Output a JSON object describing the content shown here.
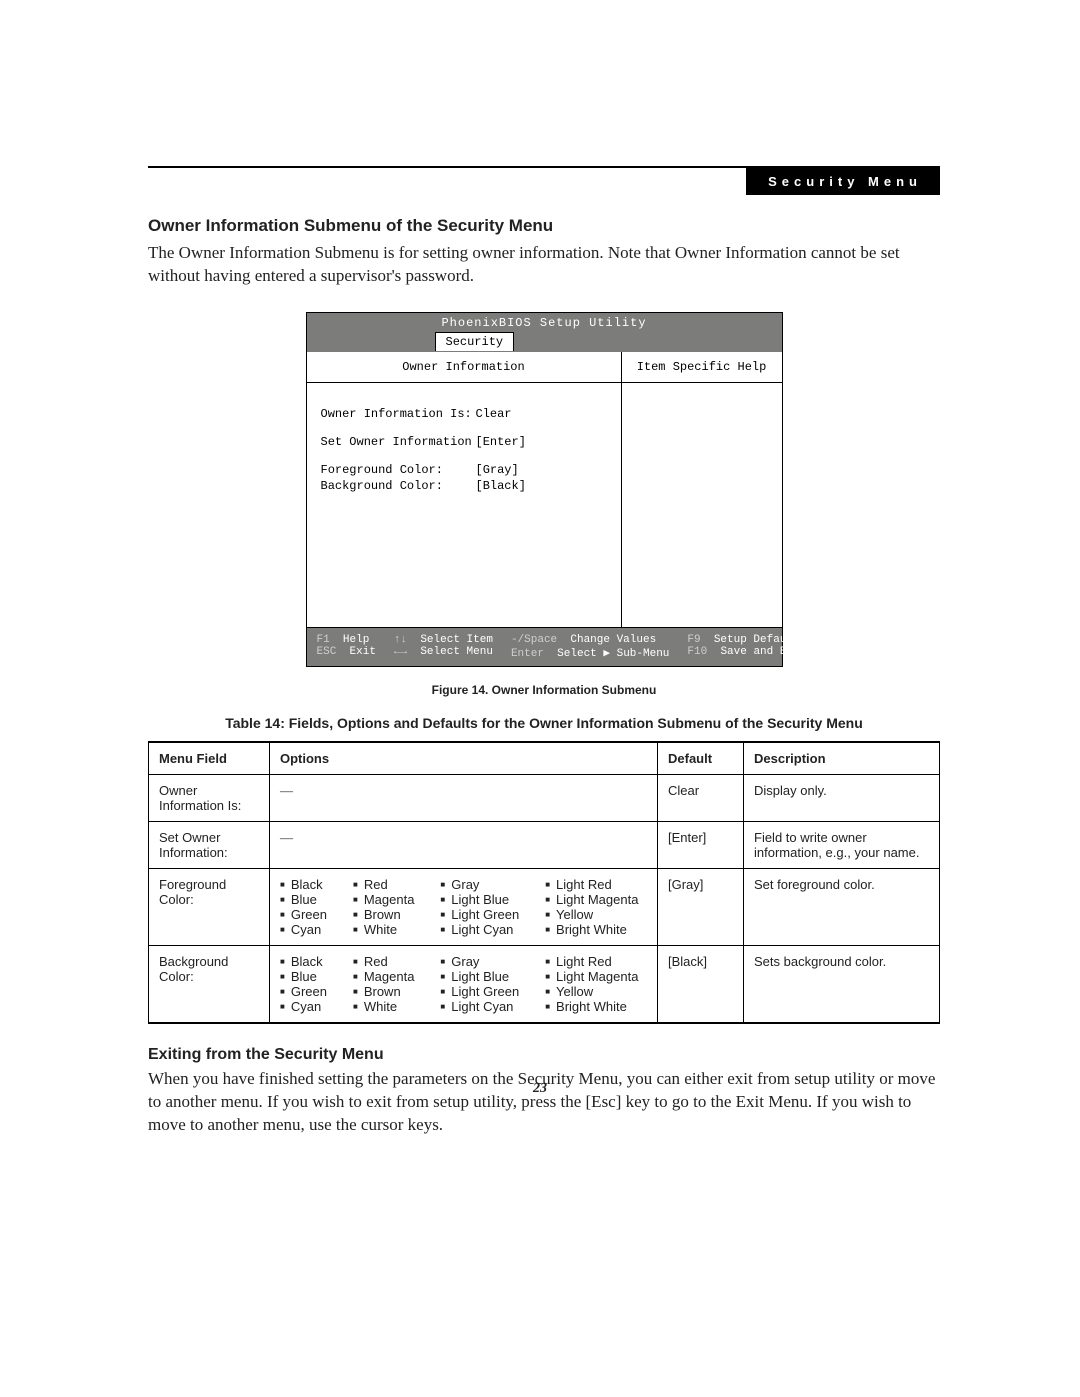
{
  "header": {
    "badge": "Security Menu"
  },
  "section1": {
    "title": "Owner Information Submenu of the Security Menu",
    "body": "The Owner Information Submenu is for setting owner information. Note that Owner Information cannot be set without having entered a supervisor's password."
  },
  "bios": {
    "utility_title": "PhoenixBIOS Setup Utility",
    "tab": "Security",
    "left_title": "Owner Information",
    "right_title": "Item Specific Help",
    "rows": [
      {
        "label": "Owner Information Is:",
        "value": "Clear"
      },
      {
        "label": "Set Owner Information",
        "value": "[Enter]"
      },
      {
        "label": "Foreground Color:",
        "value": "[Gray]"
      },
      {
        "label": "Background Color:",
        "value": "[Black]"
      }
    ],
    "footer": {
      "f1": "F1",
      "help": "Help",
      "esc": "ESC",
      "exit": "Exit",
      "updown": "↑↓",
      "select_item": "Select Item",
      "leftright": "←→",
      "select_menu": "Select Menu",
      "minus_space": "-/Space",
      "change_values": "Change Values",
      "enter": "Enter",
      "select_sub": "Select ▶ Sub-Menu",
      "f9": "F9",
      "setup_defaults": "Setup Defaults",
      "f10": "F10",
      "save_exit": "Save and Exit"
    }
  },
  "figure_caption": "Figure 14.   Owner Information Submenu",
  "table_caption": "Table 14: Fields, Options and Defaults for the Owner Information Submenu of the Security Menu",
  "table": {
    "headers": {
      "field": "Menu Field",
      "options": "Options",
      "default": "Default",
      "desc": "Description"
    },
    "rows": [
      {
        "field": "Owner Information Is:",
        "options_dash": "—",
        "default": "Clear",
        "desc": "Display only."
      },
      {
        "field": "Set Owner Information:",
        "options_dash": "—",
        "default": "[Enter]",
        "desc": "Field to write owner information, e.g., your name."
      },
      {
        "field": "Foreground Color:",
        "colors": {
          "c1": [
            "Black",
            "Blue",
            "Green",
            "Cyan"
          ],
          "c2": [
            "Red",
            "Magenta",
            "Brown",
            "White"
          ],
          "c3": [
            "Gray",
            "Light Blue",
            "Light Green",
            "Light Cyan"
          ],
          "c4": [
            "Light Red",
            "Light Magenta",
            "Yellow",
            "Bright White"
          ]
        },
        "default": "[Gray]",
        "desc": "Set foreground color."
      },
      {
        "field": "Background Color:",
        "colors": {
          "c1": [
            "Black",
            "Blue",
            "Green",
            "Cyan"
          ],
          "c2": [
            "Red",
            "Magenta",
            "Brown",
            "White"
          ],
          "c3": [
            "Gray",
            "Light Blue",
            "Light Green",
            "Light Cyan"
          ],
          "c4": [
            "Light Red",
            "Light Magenta",
            "Yellow",
            "Bright White"
          ]
        },
        "default": "[Black]",
        "desc": "Sets background color."
      }
    ]
  },
  "section2": {
    "title": "Exiting from the Security Menu",
    "body": "When you have finished setting the parameters on the Security Menu, you can either exit from setup utility or move to another menu. If you wish to exit from setup utility, press the [Esc] key to go to the Exit Menu. If you wish to move to another menu, use the cursor keys."
  },
  "page_number": "23"
}
